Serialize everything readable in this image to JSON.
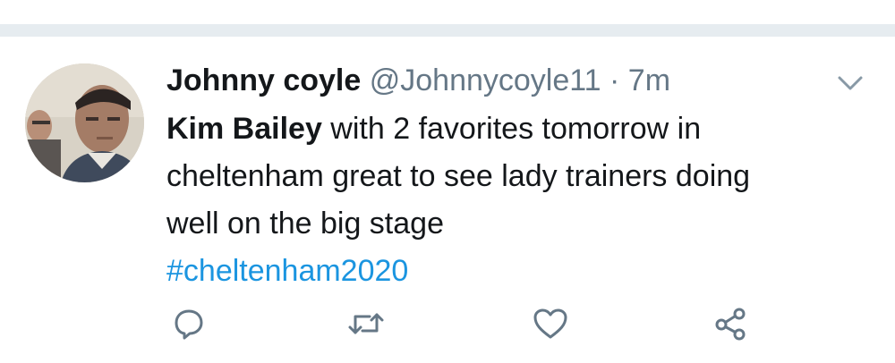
{
  "tweet": {
    "display_name": "Johnny coyle",
    "handle": "@Johnnycoyle11",
    "separator": "·",
    "time": "7m",
    "text_bold": "Kim Bailey",
    "text_line1_rest": " with 2 favorites tomorrow in",
    "text_line2": "cheltenham great to see lady trainers doing",
    "text_line3": "well on the big stage",
    "hashtag": "#cheltenham2020"
  },
  "icons": {
    "caret": "chevron-down-icon",
    "reply": "reply-icon",
    "retweet": "retweet-icon",
    "like": "heart-icon",
    "share": "share-icon"
  },
  "colors": {
    "text": "#14171a",
    "secondary": "#657786",
    "link": "#1b95e0",
    "divider": "#e6ecf0"
  }
}
